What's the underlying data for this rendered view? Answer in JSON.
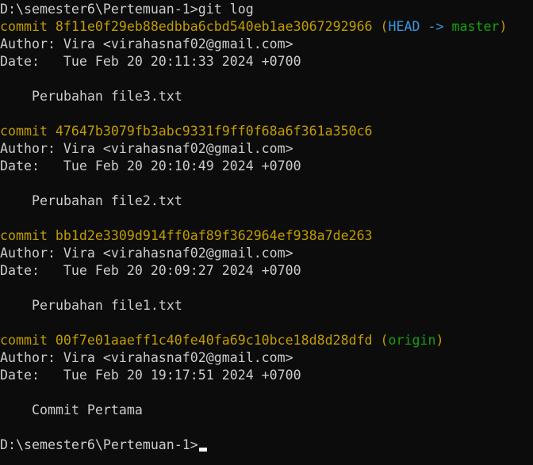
{
  "terminal": {
    "prompt_command": "D:\\semester6\\Pertemuan-1>git log",
    "final_prompt": "D:\\semester6\\Pertemuan-1>",
    "colors": {
      "background": "#0c0c0c",
      "text": "#cccccc",
      "commit": "#c19c00",
      "head": "#3a96dd",
      "branch": "#13a10e"
    },
    "commits": [
      {
        "commit_line": "commit 8f11e0f29eb88edbba6cbd540eb1ae3067292966",
        "paren_open": "(",
        "head_label": "HEAD ->",
        "branch_label": "master",
        "paren_close": ")",
        "author": "Author: Vira <virahasnaf02@gmail.com>",
        "date": "Date:   Tue Feb 20 20:11:33 2024 +0700",
        "message": "Perubahan file3.txt"
      },
      {
        "commit_line": "commit 47647b3079fb3abc9331f9ff0f68a6f361a350c6",
        "author": "Author: Vira <virahasnaf02@gmail.com>",
        "date": "Date:   Tue Feb 20 20:10:49 2024 +0700",
        "message": "Perubahan file2.txt"
      },
      {
        "commit_line": "commit bb1d2e3309d914ff0af89f362964ef938a7de263",
        "author": "Author: Vira <virahasnaf02@gmail.com>",
        "date": "Date:   Tue Feb 20 20:09:27 2024 +0700",
        "message": "Perubahan file1.txt"
      },
      {
        "commit_line": "commit 00f7e01aaeff1c40fe40fa69c10bce18d8d28dfd",
        "paren_open": "(",
        "branch_label": "origin",
        "paren_close": ")",
        "author": "Author: Vira <virahasnaf02@gmail.com>",
        "date": "Date:   Tue Feb 20 19:17:51 2024 +0700",
        "message": "Commit Pertama"
      }
    ]
  }
}
